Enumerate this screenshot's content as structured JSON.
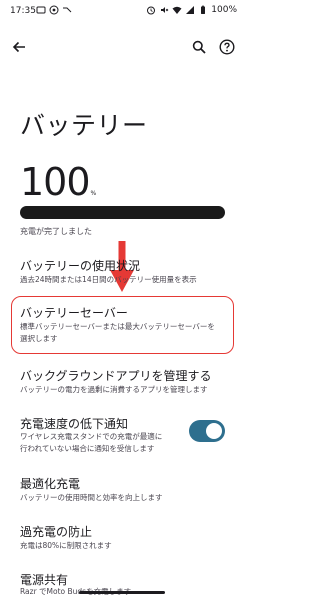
{
  "status_bar": {
    "time": "17:35",
    "battery": "100%"
  },
  "header": {
    "title": "バッテリー"
  },
  "battery": {
    "level": "100",
    "unit": "%",
    "fill_fraction": 1.0,
    "status": "充電が完了しました"
  },
  "settings": [
    {
      "title": "バッテリーの使用状況",
      "subtitle_lines": [
        "過去24時間または14日間のバッテリー使用量を表示"
      ]
    },
    {
      "title": "バッテリーセーバー",
      "subtitle_lines": [
        "標準バッテリーセーバーまたは最大バッテリーセーバーを",
        "選択します"
      ]
    },
    {
      "title": "バックグラウンドアプリを管理する",
      "subtitle_lines": [
        "バッテリーの電力を過剰に消費するアプリを管理します"
      ]
    },
    {
      "title": "充電速度の低下通知",
      "subtitle_lines": [
        "ワイヤレス充電スタンドでの充電が最適に",
        "行われていない場合に通知を受信します"
      ],
      "toggle_on": true
    },
    {
      "title": "最適化充電",
      "subtitle_lines": [
        "バッテリーの使用時間と効率を向上します"
      ]
    },
    {
      "title": "過充電の防止",
      "subtitle_lines": [
        "充電は80%に制限されます"
      ]
    },
    {
      "title": "電源共有",
      "subtitle_lines": [
        "Razr でMoto Budsを充電します"
      ]
    }
  ],
  "colors": {
    "highlight": "#e53935",
    "toggle": "#2e6f8e",
    "battery_bar": "#1a1a1a"
  },
  "icons": [
    "back-arrow-icon",
    "search-icon",
    "help-icon",
    "red-down-arrow"
  ]
}
